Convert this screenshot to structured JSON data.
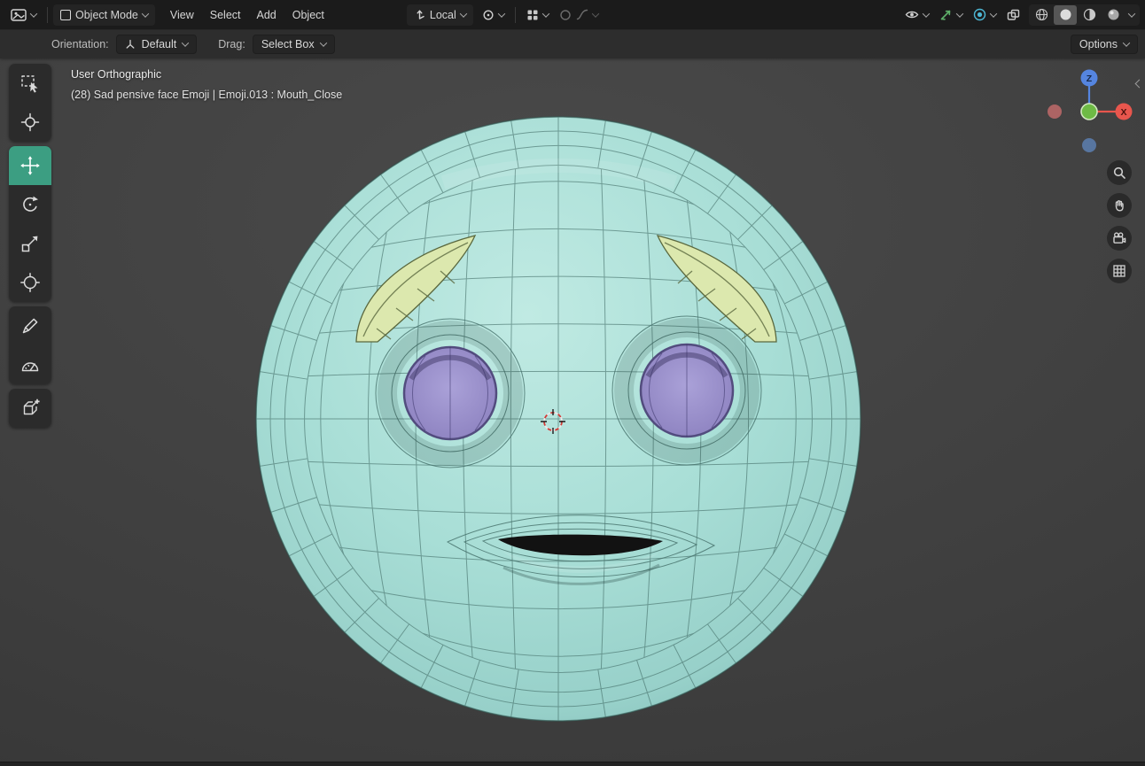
{
  "colors": {
    "header_bg": "#1b1b1b",
    "toolbar_row_bg": "#2d2d2d",
    "viewport_bg": "#3e3e3e",
    "active_tool": "#3c9e82",
    "face_center": "#c0eae3",
    "face_mid": "#a8ded6",
    "face_edge": "#97d0c9",
    "face_rim": "#7fbab4",
    "wire": "#45706a",
    "eye_fill": "#aaa1d8",
    "eye_edge": "#8d82c0",
    "eye_rim": "#524c7e",
    "brow_fill": "#dce8ae",
    "brow_edge": "#5a683e",
    "mouth_fill": "#121212",
    "axis_z": "#5585e0",
    "axis_x": "#e8564d",
    "axis_y": "#6eba45",
    "axis_neg_x": "#c06a6a",
    "axis_neg_z": "#5c7fb2",
    "icon_green": "#5fb06a",
    "icon_cyan": "#4db8d5"
  },
  "header": {
    "mode_label": "Object Mode",
    "menus": [
      {
        "label": "View"
      },
      {
        "label": "Select"
      },
      {
        "label": "Add"
      },
      {
        "label": "Object"
      }
    ],
    "orientation_value": "Local"
  },
  "tool_settings": {
    "orientation_label": "Orientation:",
    "orientation_value": "Default",
    "drag_label": "Drag:",
    "drag_value": "Select Box",
    "options_label": "Options"
  },
  "viewport": {
    "view_mode_text": "User Orthographic",
    "active_object_text": "(28) Sad pensive face Emoji | Emoji.013 : Mouth_Close",
    "axis_z_label": "Z",
    "axis_x_label": "X"
  }
}
